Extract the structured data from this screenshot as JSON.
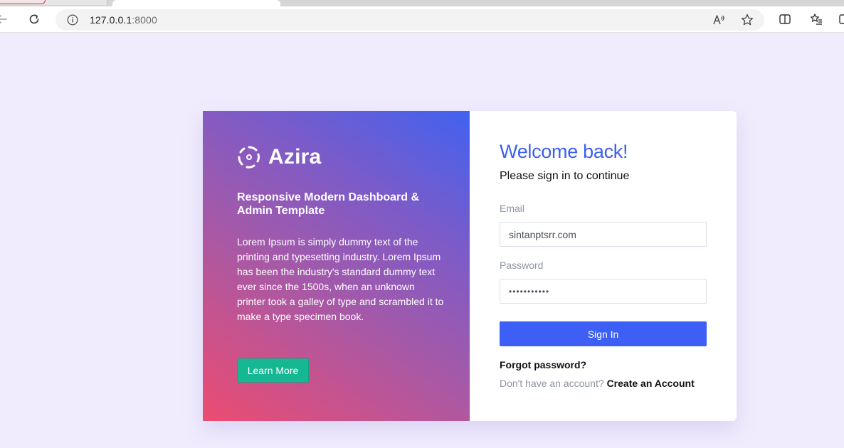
{
  "browser": {
    "url_host": "127.0.0.1",
    "url_port": ":8000"
  },
  "promo": {
    "brand_name": "Azira",
    "heading": "Responsive Modern Dashboard & Admin Template",
    "text": "Lorem Ipsum is simply dummy text of the printing and typesetting industry. Lorem Ipsum has been the industry's standard dummy text ever since the 1500s, when an unknown printer took a galley of type and scrambled it to make a type specimen book.",
    "button_label": "Learn More"
  },
  "signin": {
    "title": "Welcome back!",
    "subtitle": "Please sign in to continue",
    "email_label": "Email",
    "email_value": "sintanptsrr.com",
    "password_label": "Password",
    "password_value": "•••••••••••",
    "button_label": "Sign In",
    "forgot_label": "Forgot password?",
    "no_account_text": "Don't have an account?",
    "create_account_label": "Create an Account"
  },
  "colors": {
    "accent": "#3d5ff5",
    "title": "#3d5ff1",
    "learn_more": "#16b894",
    "page_bg": "#f0ecfd"
  }
}
